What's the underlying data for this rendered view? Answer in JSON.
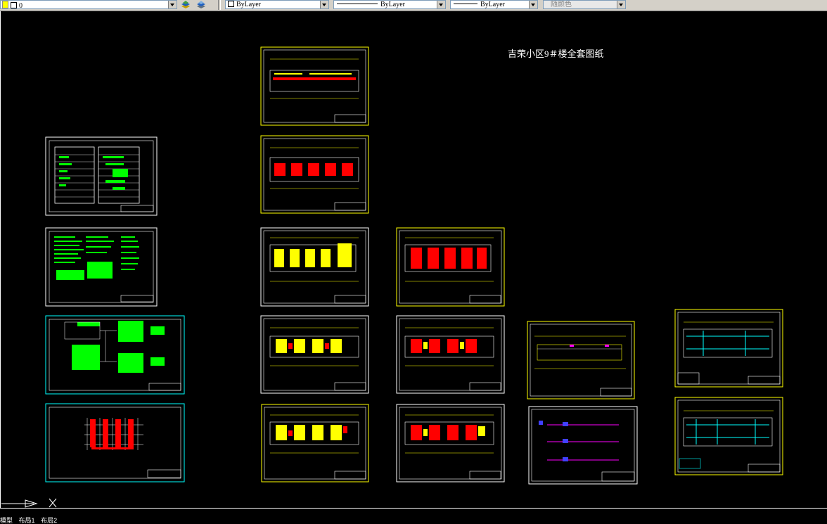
{
  "toolbar": {
    "layer_value": "0",
    "color_label": "ByLayer",
    "linetype_label": "ByLayer",
    "lineweight_label": "ByLayer",
    "plotstyle_label": "随颜色"
  },
  "drawing": {
    "title": "吉荣小区9＃楼全套图纸"
  },
  "icons": [
    "layer-state-icon",
    "layer-previous-icon",
    "layer-props-icon",
    "ucs-icon"
  ],
  "tabs": [
    "模型",
    "布局1",
    "布局2"
  ],
  "colors": {
    "background": "#000000",
    "frame_yellow": "#ffff00",
    "frame_white": "#ffffff",
    "frame_cyan": "#00ffff",
    "text_green": "#00ff00",
    "wall_red": "#ff0000"
  }
}
